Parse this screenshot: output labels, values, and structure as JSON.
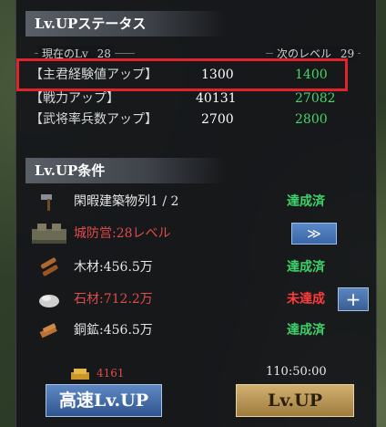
{
  "status": {
    "title": "Lv.UPステータス",
    "current_level_label": "現在のLv",
    "current_level": "28",
    "next_level_label": "次のレベル",
    "next_level": "29",
    "rows": [
      {
        "label": "【主君経験値アップ】",
        "current": "1300",
        "next": "1400"
      },
      {
        "label": "【戦力アップ】",
        "current": "40131",
        "next": "27082"
      },
      {
        "label": "【武将率兵数アップ】",
        "current": "2700",
        "next": "2800"
      }
    ]
  },
  "conditions": {
    "title": "Lv.UP条件",
    "rows": [
      {
        "label": "閑暇建築物列1 / 2",
        "status": "達成済",
        "icon": "hammer-icon"
      },
      {
        "label": "城防営:28レベル",
        "status": "",
        "icon": "building-icon",
        "go": "≫"
      },
      {
        "label": "木材:456.5万",
        "status": "達成済",
        "icon": "wood-icon"
      },
      {
        "label": "石材:712.2万",
        "status": "未達成",
        "icon": "stone-icon",
        "plus": "+"
      },
      {
        "label": "銅鉱:456.5万",
        "status": "達成済",
        "icon": "copper-icon"
      }
    ]
  },
  "cost": {
    "gold": "4161",
    "time": "110:50:00"
  },
  "buttons": {
    "fast": "高速Lv.UP",
    "up": "Lv.UP"
  },
  "colors": {
    "ok": "#3ed36a",
    "ng": "#ff3b3b",
    "next": "#4bd36b",
    "highlight": "#e0242e"
  }
}
